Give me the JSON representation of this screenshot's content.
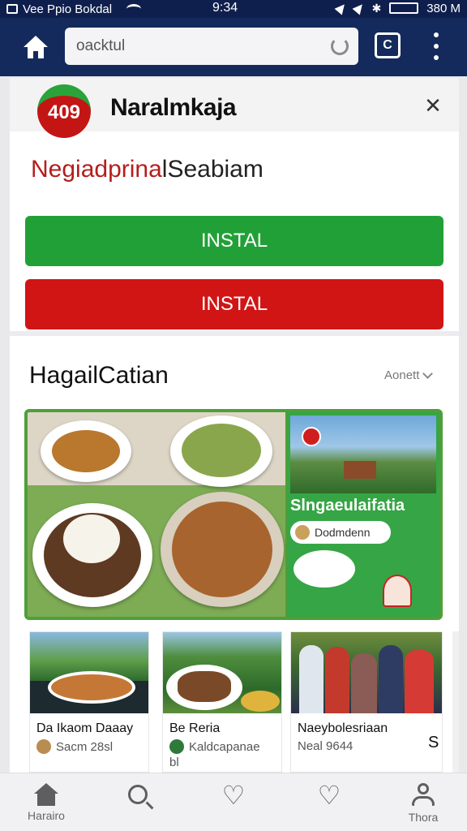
{
  "status_bar": {
    "carrier": "Vee Ppio Bokdal",
    "time": "9:34",
    "battery_text": "380 M",
    "battery_level": 1.0,
    "icons": [
      "sim-icon",
      "wifi-icon",
      "location-arrow-icon",
      "signal-icon",
      "bluetooth-icon",
      "battery-icon"
    ]
  },
  "browser": {
    "url": "oacktul",
    "tab_label": "C"
  },
  "app_banner": {
    "logo_text": "409",
    "name": "Naralmkaja",
    "subtitle_red": "Negiadprina",
    "subtitle_dark": "lSeabiam",
    "install_green": "INSTAL",
    "install_red": "INSTAL",
    "colors": {
      "green": "#22a038",
      "red": "#d11515"
    }
  },
  "section": {
    "title": "HagailCatian",
    "more": "Aonett"
  },
  "promo": {
    "title": "Slngaeulaifatia",
    "subtitle": "Dodmdenn"
  },
  "cards": [
    {
      "title": "Da Ikaom Daaay",
      "meta": "Sacm 28sl"
    },
    {
      "title": "Be Reria",
      "meta": "Kaldcapanae",
      "meta2": "bl"
    },
    {
      "title": "Naeybolesriaan",
      "meta": "Neal 9644"
    }
  ],
  "card_partial_letter": "S",
  "bottom_nav": [
    {
      "label": "Harairo",
      "icon": "home-icon"
    },
    {
      "label": "",
      "icon": "search-icon"
    },
    {
      "label": "",
      "icon": "heart-outline-icon"
    },
    {
      "label": "",
      "icon": "heart-icon"
    },
    {
      "label": "Thora",
      "icon": "profile-icon"
    }
  ]
}
